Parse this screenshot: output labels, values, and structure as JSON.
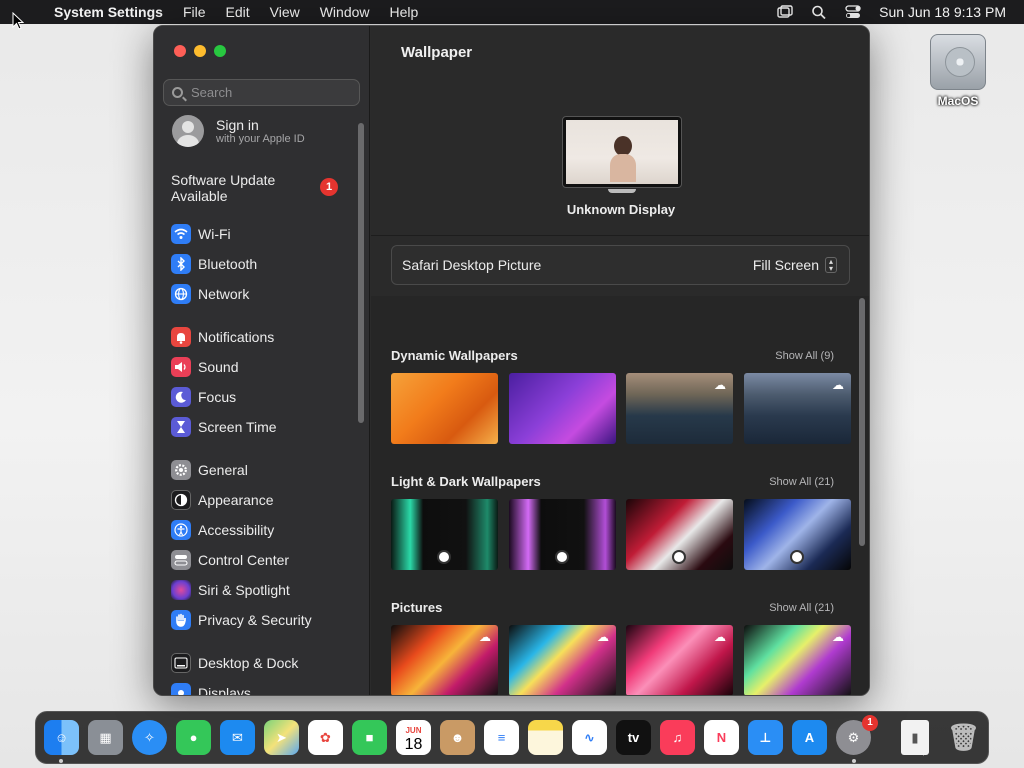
{
  "menubar": {
    "app_name": "System Settings",
    "menus": [
      "File",
      "Edit",
      "View",
      "Window",
      "Help"
    ],
    "clock": "Sun Jun 18  9:13 PM"
  },
  "desktop": {
    "drive_label": "MacOS"
  },
  "sidebar": {
    "search_placeholder": "Search",
    "signin_title": "Sign in",
    "signin_subtitle": "with your Apple ID",
    "software_update": "Software Update Available",
    "update_badge": "1",
    "items": [
      {
        "label": "Wi-Fi",
        "icon": "wifi-icon",
        "color": "#2f7df6"
      },
      {
        "label": "Bluetooth",
        "icon": "bluetooth-icon",
        "color": "#2f7df6"
      },
      {
        "label": "Network",
        "icon": "globe-icon",
        "color": "#2f7df6"
      },
      {
        "label": "Notifications",
        "icon": "bell-icon",
        "color": "#e8463f"
      },
      {
        "label": "Sound",
        "icon": "speaker-icon",
        "color": "#ea3f57"
      },
      {
        "label": "Focus",
        "icon": "moon-icon",
        "color": "#5b5bd6"
      },
      {
        "label": "Screen Time",
        "icon": "hourglass-icon",
        "color": "#5b5bd6"
      },
      {
        "label": "General",
        "icon": "gear-icon",
        "color": "#8e8e93"
      },
      {
        "label": "Appearance",
        "icon": "appearance-icon",
        "color": "#1c1c1e"
      },
      {
        "label": "Accessibility",
        "icon": "accessibility-icon",
        "color": "#2f7df6"
      },
      {
        "label": "Control Center",
        "icon": "control-center-icon",
        "color": "#8e8e93"
      },
      {
        "label": "Siri & Spotlight",
        "icon": "siri-icon",
        "color": "#b44ac4"
      },
      {
        "label": "Privacy & Security",
        "icon": "hand-icon",
        "color": "#2f7df6"
      },
      {
        "label": "Desktop & Dock",
        "icon": "dock-icon",
        "color": "#1c1c1e"
      },
      {
        "label": "Displays",
        "icon": "display-icon",
        "color": "#2f7df6"
      }
    ]
  },
  "main": {
    "title": "Wallpaper",
    "display_name": "Unknown Display",
    "current_wallpaper": "Safari Desktop Picture",
    "fill_mode": "Fill Screen",
    "sections": [
      {
        "title": "Dynamic Wallpapers",
        "show_all": "Show All (9)"
      },
      {
        "title": "Light & Dark Wallpapers",
        "show_all": "Show All (21)"
      },
      {
        "title": "Pictures",
        "show_all": "Show All (21)"
      }
    ]
  },
  "dock": {
    "apps": [
      "Finder",
      "Launchpad",
      "Safari",
      "Messages",
      "Mail",
      "Maps",
      "Photos",
      "FaceTime",
      "Calendar",
      "Contacts",
      "Reminders",
      "Notes",
      "Freeform",
      "TV",
      "Music",
      "News",
      "Keynote",
      "App Store",
      "System Settings",
      "Archive",
      "Trash"
    ],
    "calendar_month": "JUN",
    "calendar_day": "18",
    "tv_label": "tv",
    "settings_badge": "1"
  }
}
